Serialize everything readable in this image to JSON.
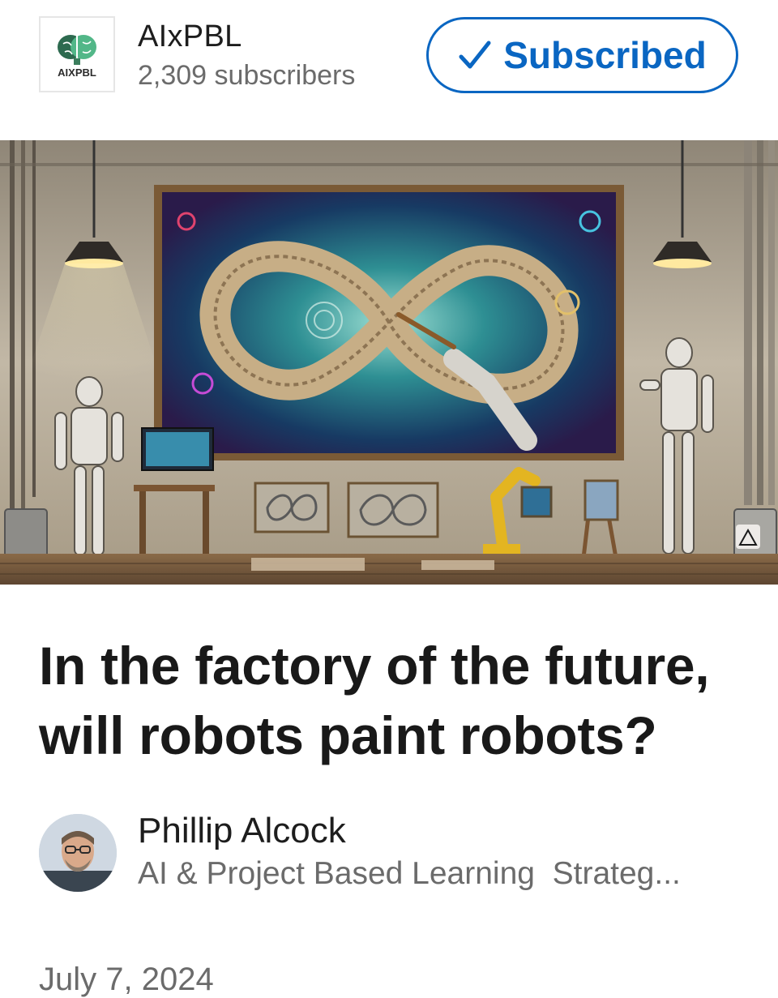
{
  "newsletter": {
    "logo_text": "AIXPBL",
    "name": "AIxPBL",
    "subscribers": "2,309 subscribers"
  },
  "subscribe_button": {
    "label": "Subscribed",
    "icon": "check-icon",
    "color": "#0a66c2"
  },
  "cover_image": {
    "description_icon": "robots-painting-infinity-artwork",
    "corner_icon": "triangle-icon"
  },
  "article": {
    "title": "In the factory of the future, will robots paint robots?"
  },
  "author": {
    "name": "Phillip Alcock",
    "headline": "AI & Project Based Learning  Strateg..."
  },
  "publish_date": "July 7, 2024"
}
